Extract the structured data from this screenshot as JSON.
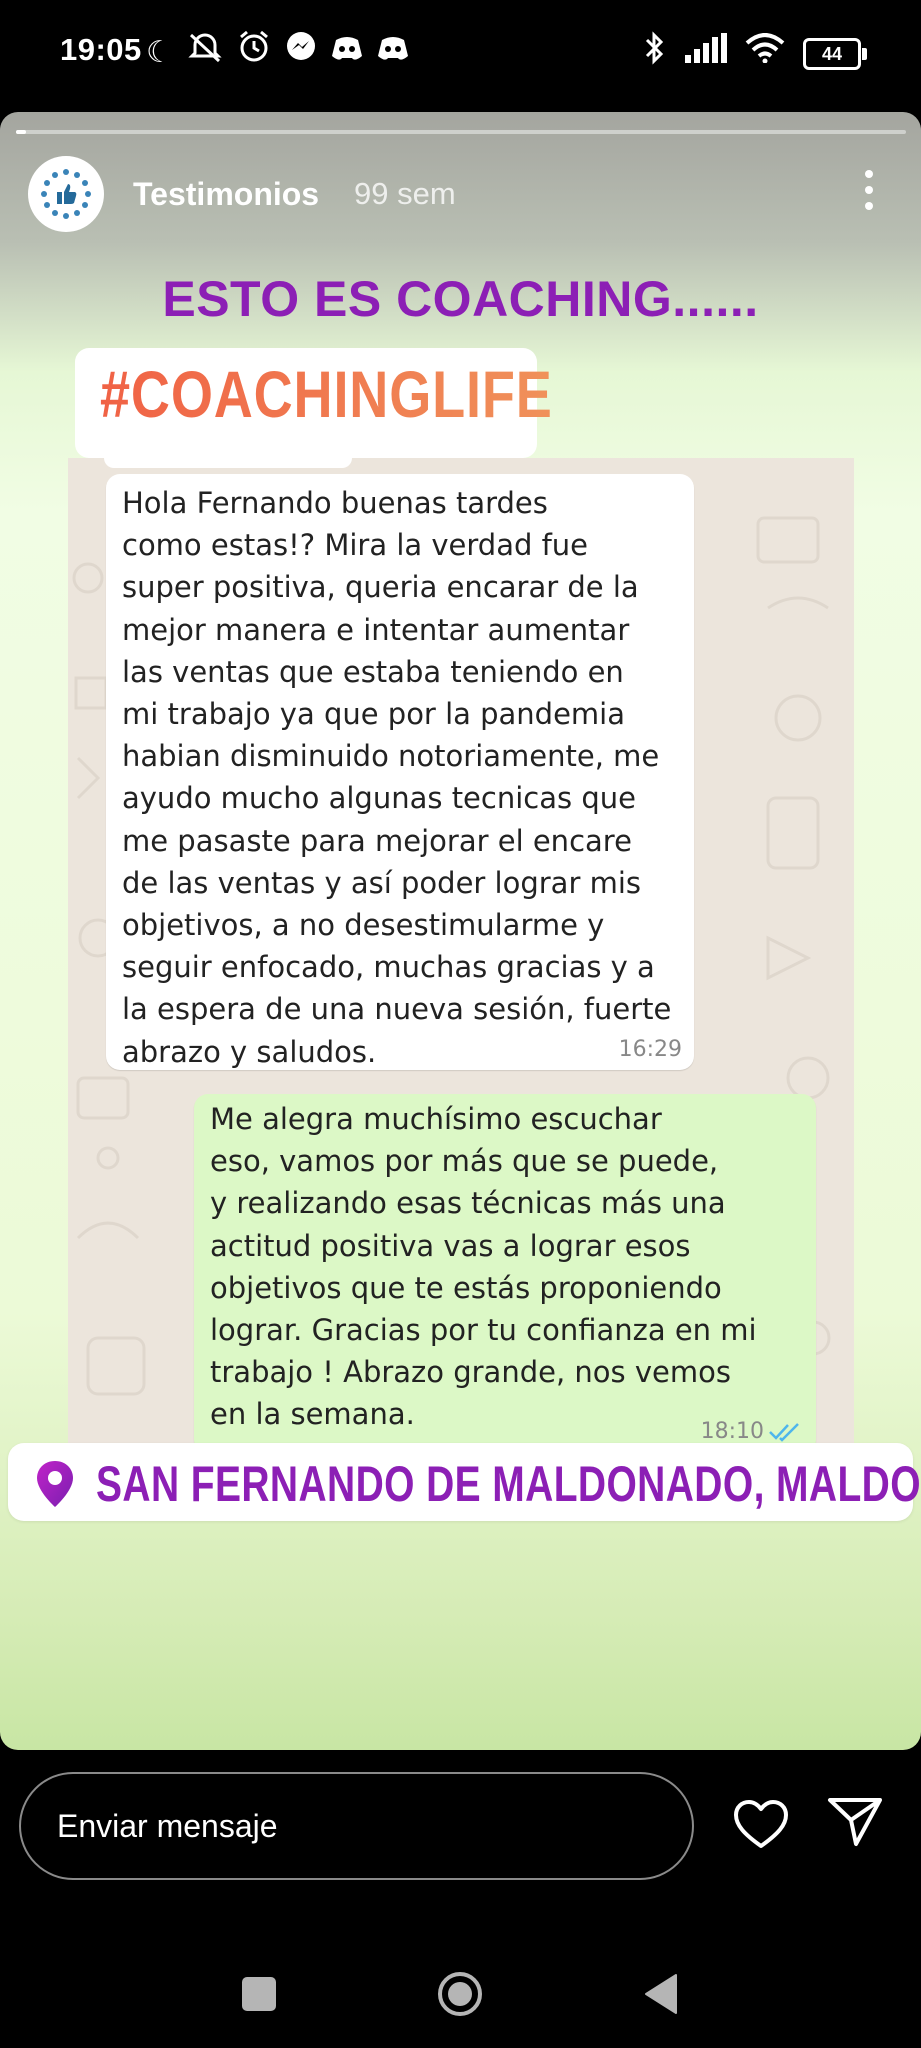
{
  "status_bar": {
    "time": "19:05",
    "left_icons": [
      "moon-icon",
      "alarm-off-icon",
      "alarm-icon",
      "messenger-icon",
      "discord-icon",
      "discord-icon"
    ],
    "right_icons": [
      "bluetooth-icon",
      "signal-icon",
      "wifi-icon"
    ],
    "battery": "44"
  },
  "story": {
    "account_name": "Testimonios",
    "time_ago": "99 sem",
    "headline": "ESTO ES COACHING......",
    "hashtag": "#COACHINGLIFE",
    "chat": {
      "incoming": {
        "text": "Hola Fernando buenas tardes\ncomo estas!? Mira la verdad fue\nsuper positiva, queria encarar de la\nmejor manera e intentar aumentar\nlas ventas que estaba teniendo en\nmi trabajo ya que por la pandemia\nhabian disminuido notoriamente, me\nayudo mucho algunas tecnicas que\nme pasaste para mejorar el encare\nde las ventas y así  poder lograr mis\nobjetivos, a no desestimularme y\nseguir enfocado, muchas gracias y a\nla espera de una nueva sesión, fuerte\nabrazo y saludos.",
        "time": "16:29"
      },
      "outgoing": {
        "text": "Me alegra muchísimo escuchar\neso, vamos por más que se puede,\ny realizando esas técnicas más una\nactitud positiva vas a lograr esos\nobjetivos que te estás proponiendo\nlograr. Gracias por tu confianza en mi\ntrabajo ! Abrazo grande, nos vemos\nen la semana.",
        "time": "18:10"
      }
    },
    "location": "SAN FERNANDO DE MALDONADO, MALDONADO,..."
  },
  "reply_bar": {
    "placeholder": "Enviar mensaje"
  },
  "colors": {
    "headline": "#8c1fb5",
    "hashtag": "#ee6c4d",
    "bubble_out": "#dcf8c6",
    "chat_bg": "#ece5dc"
  }
}
